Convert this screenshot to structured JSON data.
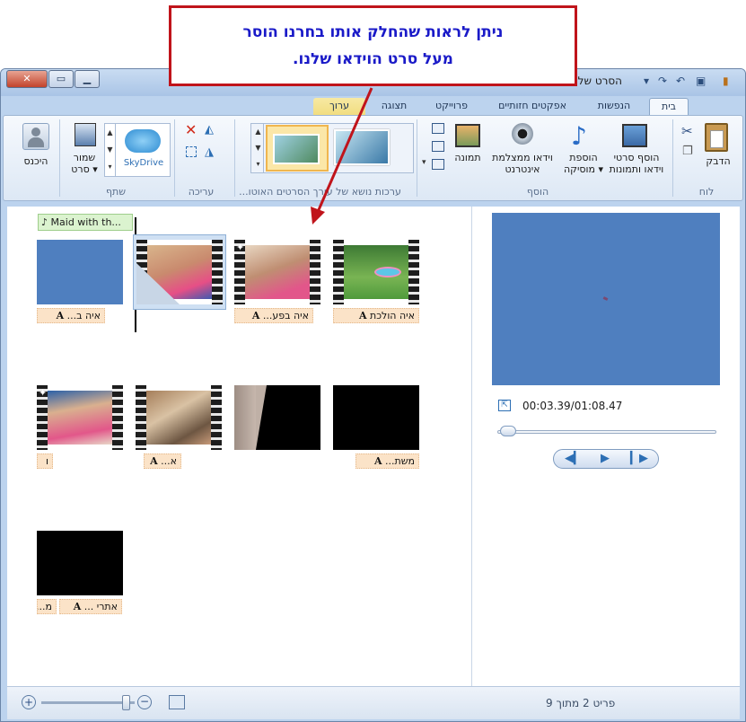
{
  "callout": {
    "line1": "ניתן לראות שהחלק אותו בחרנו הוסר",
    "line2": "מעל סרט הוידאו שלנו."
  },
  "window": {
    "title": "הסרט שלי",
    "close_glyph": "✕",
    "max_glyph": "▭",
    "min_glyph": "▁"
  },
  "tabs": {
    "app_menu": "▾ ▤",
    "home": "בית",
    "animations": "הנפשות",
    "visual_effects": "אפקטים חזותיים",
    "project": "פרוייקט",
    "view": "תצוגה",
    "edit": "ערוך",
    "help": "?"
  },
  "ribbon": {
    "groups": {
      "clipboard": "לוח",
      "add": "הוסף",
      "themes": "ערכות נושא של עורך הסרטים האוטו...",
      "editing": "עריכה",
      "share": "שתף"
    },
    "buttons": {
      "paste": "הדבק",
      "add_videos_photos_1": "הוסף סרטי",
      "add_videos_photos_2": "וידאו ותמונות",
      "add_music_1": "הוספת",
      "add_music_2": "מוסיקה",
      "webcam_1": "וידאו ממצלמת",
      "webcam_2": "אינטרנט",
      "snapshot": "תמונה",
      "skydrive": "SkyDrive",
      "save_movie_1": "שמור",
      "save_movie_2": "סרט",
      "sign_in": "היכנס"
    }
  },
  "storyboard": {
    "music_label": "Maid with th...",
    "captions": [
      "איה הולכת",
      "איה בפע...",
      "איה ב...",
      "משת...",
      "א...",
      "ו",
      "אתרי ...",
      "מ..."
    ]
  },
  "preview": {
    "time": "00:03.39/01:08.47",
    "progress": 0.05
  },
  "status": {
    "item_text": "פריט 2 מתוך 9",
    "zoom_level": 0.9
  },
  "colors": {
    "callout_border": "#c0141b",
    "callout_text": "#1a1ac8",
    "preview_blue": "#4f7fbf"
  }
}
